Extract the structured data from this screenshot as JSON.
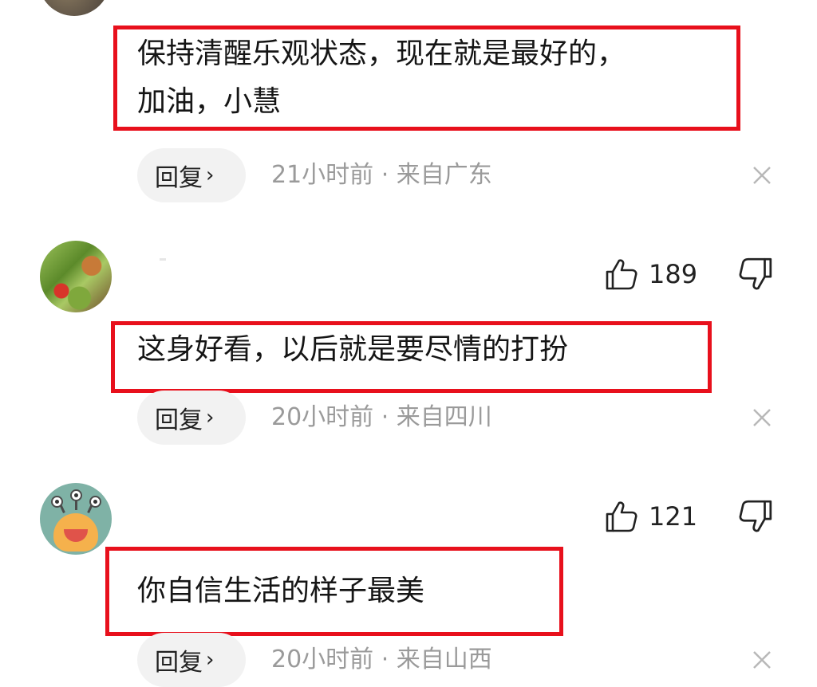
{
  "comments": [
    {
      "text": "保持清醒乐观状态，现在就是最好的，\n加油，小慧",
      "reply_label": "回复",
      "meta": "21小时前 · 来自广东",
      "avatar": "scenery-avatar"
    },
    {
      "likes": "189",
      "text": "这身好看，以后就是要尽情的打扮",
      "reply_label": "回复",
      "meta": "20小时前 · 来自四川",
      "avatar": "food-avatar"
    },
    {
      "likes": "121",
      "text": "你自信生活的样子最美",
      "reply_label": "回复",
      "meta": "20小时前 · 来自山西",
      "avatar": "monster-avatar"
    }
  ],
  "icons": {
    "like": "thumbs-up-icon",
    "dislike": "thumbs-down-icon",
    "close": "close-icon",
    "chevron": "chevron-right-icon"
  },
  "colors": {
    "highlight_box": "#e8101c",
    "meta_text": "#9a9a9a",
    "reply_pill_bg": "#f2f2f2"
  }
}
